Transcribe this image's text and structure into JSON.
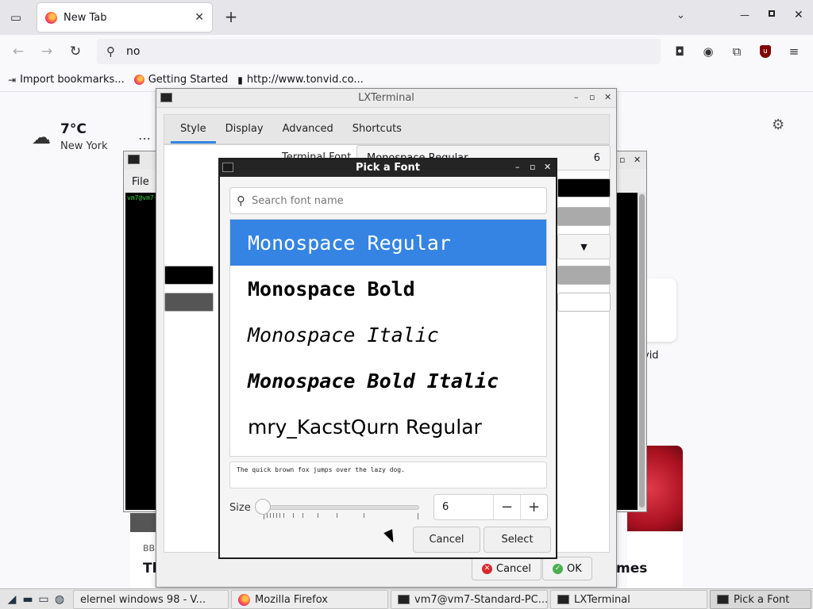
{
  "browser": {
    "tab_title": "New Tab",
    "url_text": "no",
    "bookmarks": [
      "Import bookmarks...",
      "Getting Started",
      "http://www.tonvid.co..."
    ]
  },
  "newtab": {
    "temperature": "7°C",
    "city": "New York",
    "shortcut_label": "vid",
    "story_source": "BB",
    "story_title_left": "Th N",
    "story_title_right": "mes"
  },
  "bg_terminal": {
    "menu": "File",
    "prompt": "vm7@vm7-"
  },
  "lxterminal_prefs": {
    "title": "LXTerminal",
    "tabs": [
      "Style",
      "Display",
      "Advanced",
      "Shortcuts"
    ],
    "active_tab": "Style",
    "terminal_font_label": "Terminal Font",
    "terminal_font_name": "Monospace Regular",
    "terminal_font_size": "6",
    "cancel_label": "Cancel",
    "ok_label": "OK"
  },
  "font_dialog": {
    "title": "Pick a Font",
    "search_placeholder": "Search font name",
    "fonts": [
      "Monospace Regular",
      "Monospace Bold",
      "Monospace Italic",
      "Monospace Bold Italic",
      "mry_KacstQurn Regular"
    ],
    "selected_font": "Monospace Regular",
    "preview_text": "The quick brown fox jumps over the lazy dog.",
    "size_label": "Size",
    "size_value": "6",
    "cancel_label": "Cancel",
    "select_label": "Select"
  },
  "taskbar": {
    "tasks": [
      "elernel windows 98 - V...",
      "Mozilla Firefox",
      "vm7@vm7-Standard-PC...",
      "LXTerminal",
      "Pick a Font"
    ],
    "active_task": "Pick a Font"
  },
  "colors": {
    "selection": "#3584e4",
    "dialog_titlebar": "#242424"
  }
}
